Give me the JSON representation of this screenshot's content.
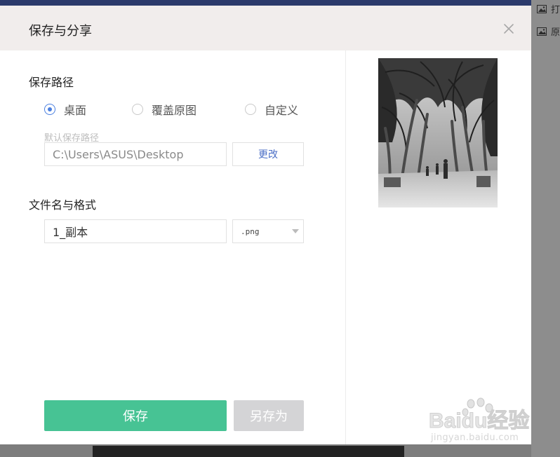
{
  "background": {
    "side_items": [
      {
        "icon": "image-icon",
        "label": "打"
      },
      {
        "icon": "image-icon",
        "label": "原"
      }
    ]
  },
  "dialog": {
    "title": "保存与分享",
    "close_icon": "close-icon",
    "save_path_label": "保存路径",
    "radio_options": [
      {
        "label": "桌面",
        "checked": true
      },
      {
        "label": "覆盖原图",
        "checked": false
      },
      {
        "label": "自定义",
        "checked": false
      }
    ],
    "default_path_hint": "默认保存路径",
    "path_value": "C:\\Users\\ASUS\\Desktop",
    "change_button": "更改",
    "filename_label": "文件名与格式",
    "filename_value": "1_副本",
    "format_value": ".png",
    "save_button": "保存",
    "save_as_button": "另存为"
  },
  "watermark": {
    "logo_text": "Baidu经验",
    "url": "jingyan.baidu.com"
  },
  "colors": {
    "accent_green": "#47c394",
    "radio_blue": "#4a7fe0",
    "link_blue": "#4a6ec6",
    "header_bg": "#f1edec"
  }
}
